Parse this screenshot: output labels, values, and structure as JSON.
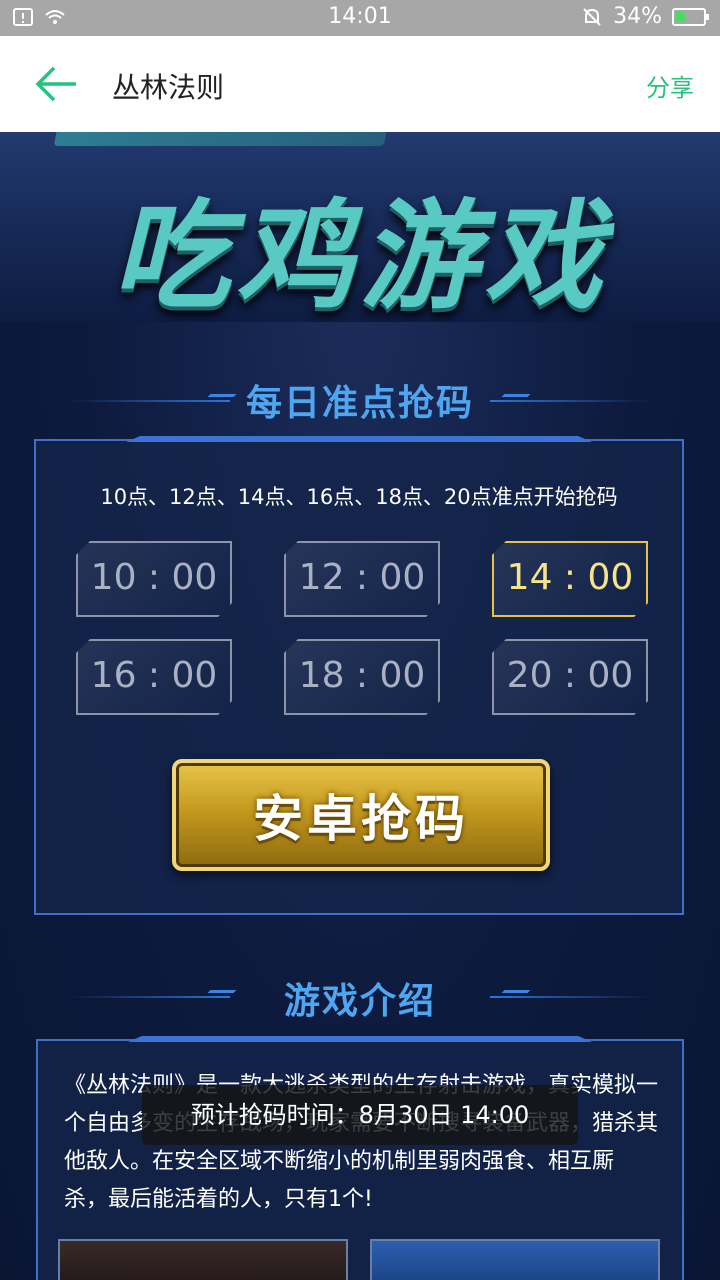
{
  "status_bar": {
    "time": "14:01",
    "battery": "34%",
    "battery_level": 0.34
  },
  "app_bar": {
    "title": "丛林法则",
    "share": "分享"
  },
  "banner": {
    "title": "吃鸡游戏"
  },
  "daily": {
    "title": "每日准点抢码",
    "schedule": "10点、12点、14点、16点、18点、20点准点开始抢码",
    "slots": [
      "10 : 00",
      "12 : 00",
      "14 : 00",
      "16 : 00",
      "18 : 00",
      "20 : 00"
    ],
    "active_slot": "14 : 00",
    "grab_button": "安卓抢码"
  },
  "intro": {
    "title": "游戏介绍",
    "text": "《丛林法则》是一款大逃杀类型的生存射击游戏，真实模拟一个自由多变的生存战场，玩家需要不断搜寻装备武器，猎杀其他敌人。在安全区域不断缩小的机制里弱肉强食、相互厮 杀，最后能活着的人，只有1个!"
  },
  "toast": "预计抢码时间：8月30日 14:00",
  "colors": {
    "accent": "#24c37f",
    "section_title": "#4fa6f0",
    "gold": "#e6c24a"
  }
}
